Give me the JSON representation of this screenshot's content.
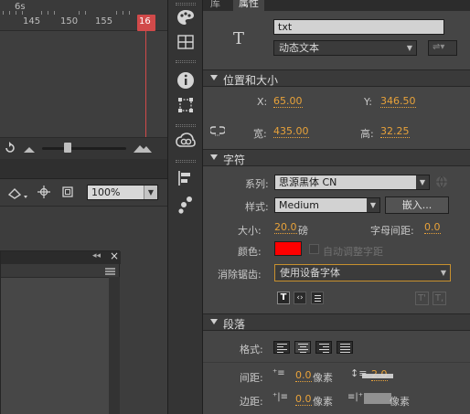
{
  "timeline": {
    "time_label": "6s",
    "frame_labels": [
      "145",
      "150",
      "155",
      "16"
    ]
  },
  "stage_toolbar": {
    "zoom": "100%"
  },
  "properties": {
    "tabs": [
      "库",
      "属性"
    ],
    "instance_name": "txt",
    "text_type": "动态文本",
    "position_section": "位置和大小",
    "x_label": "X:",
    "x_value": "65.00",
    "y_label": "Y:",
    "y_value": "346.50",
    "w_label": "宽:",
    "w_value": "435.00",
    "h_label": "高:",
    "h_value": "32.25",
    "char_section": "字符",
    "family_label": "系列:",
    "family_value": "思源黑体 CN",
    "style_label": "样式:",
    "style_value": "Medium",
    "embed_button": "嵌入...",
    "size_label": "大小:",
    "size_value": "20.0",
    "size_unit": "磅",
    "spacing_label": "字母间距:",
    "spacing_value": "0.0",
    "color_label": "颜色:",
    "color_value": "#ff0000",
    "auto_kern_label": "自动调整字距",
    "aa_label": "消除锯齿:",
    "aa_value": "使用设备字体",
    "para_section": "段落",
    "format_label": "格式:",
    "gap_label": "间距:",
    "gap_value": "0.0",
    "gap_unit": "像素",
    "line_value": "2.0",
    "margin_label": "边距:",
    "margin_value": "0.0",
    "margin_unit": "像素",
    "margin_right_unit": "像素"
  },
  "colors": {
    "accent_value": "#e8a23a",
    "playhead": "#d14a4a",
    "text_color_swatch": "#ff0000"
  }
}
